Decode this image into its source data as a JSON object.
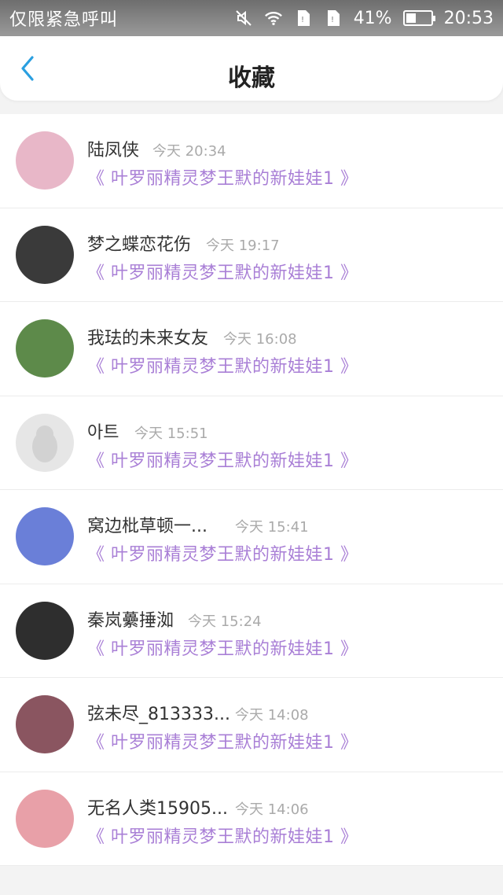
{
  "status_bar": {
    "carrier": "仅限紧急呼叫",
    "battery": "41%",
    "battery_level": 0.41,
    "time": "20:53"
  },
  "header": {
    "title": "收藏"
  },
  "favorites": [
    {
      "name": "陆凤侠",
      "time": "今天 20:34",
      "post": "《 叶罗丽精灵梦王默的新娃娃1 》",
      "avatar_color": "#e8b7c8"
    },
    {
      "name": "梦之蝶恋花伤",
      "time": "今天 19:17",
      "post": "《 叶罗丽精灵梦王默的新娃娃1 》",
      "avatar_color": "#3a3a3a"
    },
    {
      "name": "我珐的未来女友",
      "time": "今天 16:08",
      "post": "《 叶罗丽精灵梦王默的新娃娃1 》",
      "avatar_color": "#5d8a4a"
    },
    {
      "name": "아트",
      "time": "今天 15:51",
      "post": "《 叶罗丽精灵梦王默的新娃娃1 》",
      "avatar_color": "#e6e6e6"
    },
    {
      "name": "窝边枇草顿一...",
      "time": "今天 15:41",
      "post": "《 叶罗丽精灵梦王默的新娃娃1 》",
      "avatar_color": "#6a7fd8"
    },
    {
      "name": "秦岚虆捶洳",
      "time": "今天 15:24",
      "post": "《 叶罗丽精灵梦王默的新娃娃1 》",
      "avatar_color": "#2e2e2e"
    },
    {
      "name": "弦未尽_813333...",
      "time": "今天 14:08",
      "post": "《 叶罗丽精灵梦王默的新娃娃1 》",
      "avatar_color": "#8a5560"
    },
    {
      "name": "无名人类15905...",
      "time": "今天 14:06",
      "post": "《 叶罗丽精灵梦王默的新娃娃1 》",
      "avatar_color": "#e8a0a8"
    }
  ]
}
